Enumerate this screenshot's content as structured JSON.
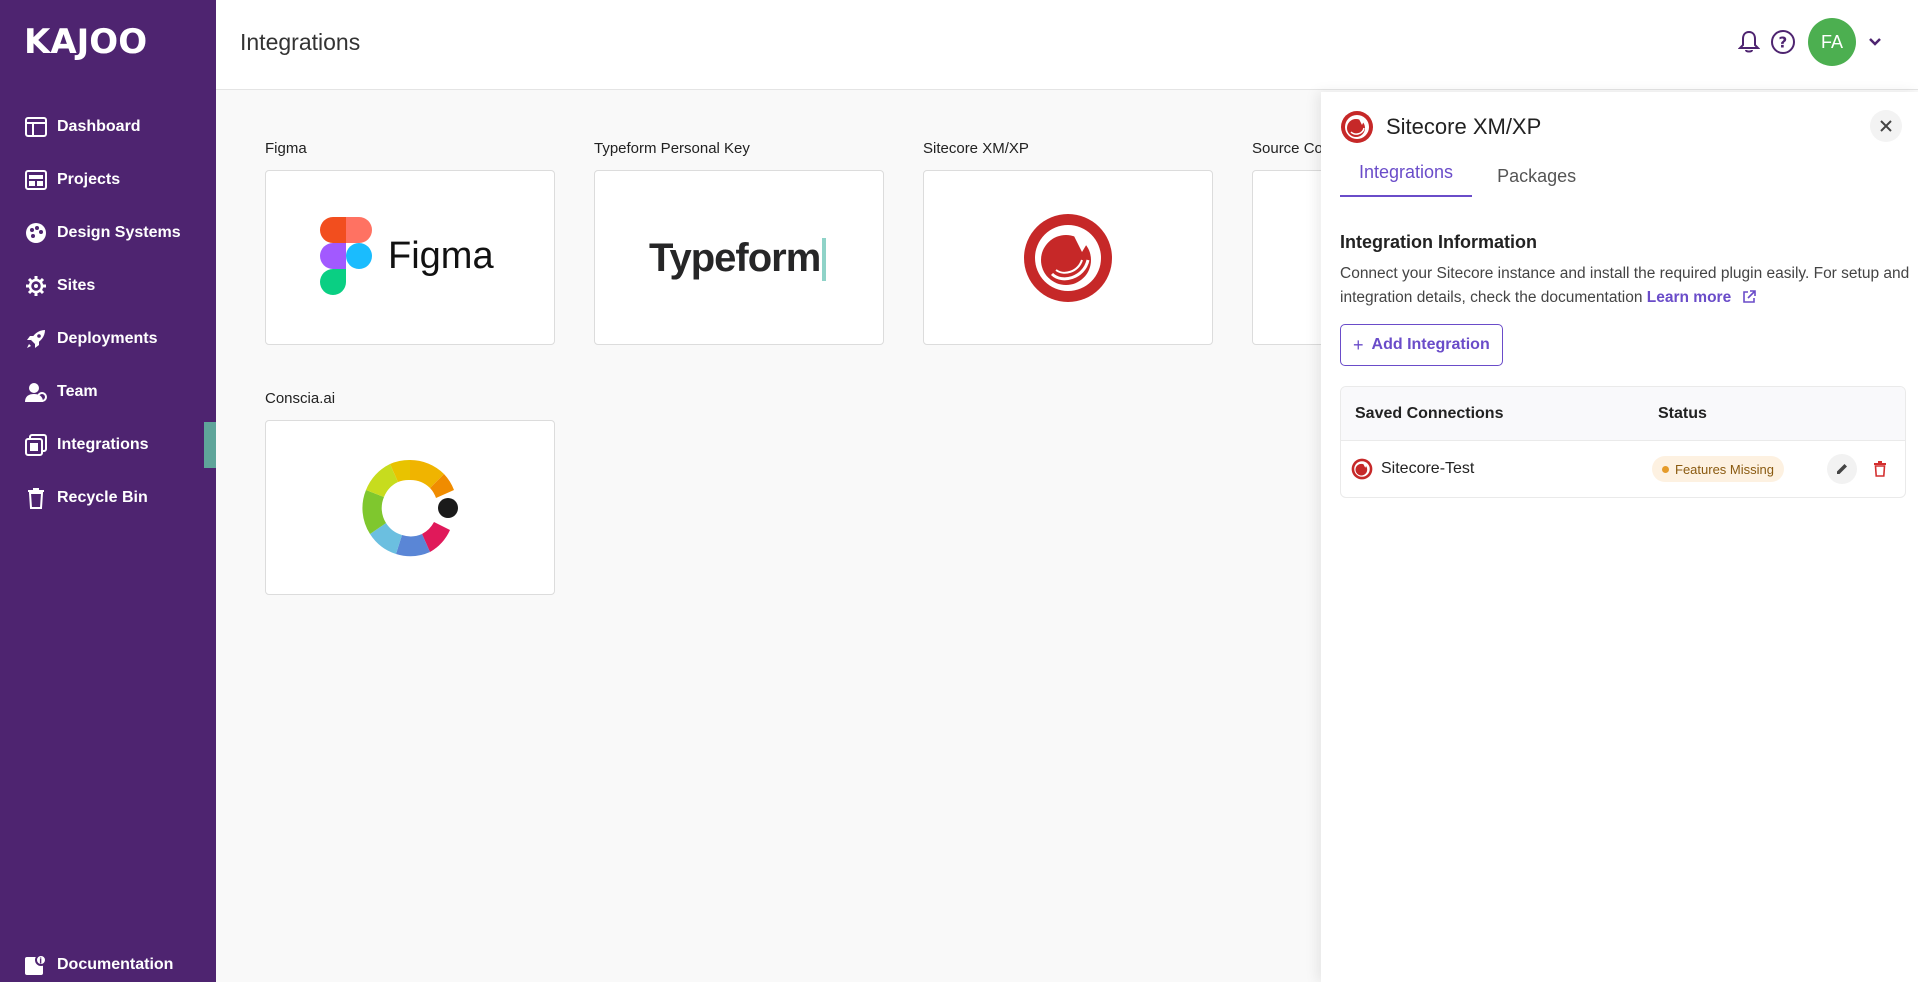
{
  "sidebar": {
    "brand": "KAJOO",
    "items": [
      {
        "label": "Dashboard"
      },
      {
        "label": "Projects"
      },
      {
        "label": "Design Systems"
      },
      {
        "label": "Sites"
      },
      {
        "label": "Deployments"
      },
      {
        "label": "Team"
      },
      {
        "label": "Integrations"
      },
      {
        "label": "Recycle Bin"
      }
    ],
    "bottom": {
      "label": "Documentation"
    }
  },
  "header": {
    "title": "Integrations",
    "avatar_initials": "FA"
  },
  "cards": [
    {
      "label": "Figma",
      "logo_text": "Figma"
    },
    {
      "label": "Typeform Personal Key",
      "logo_text": "Typeform"
    },
    {
      "label": "Sitecore XM/XP"
    },
    {
      "label": "Source Co"
    },
    {
      "label": "Conscia.ai"
    }
  ],
  "panel": {
    "title": "Sitecore XM/XP",
    "tabs": [
      {
        "label": "Integrations"
      },
      {
        "label": "Packages"
      }
    ],
    "info_title": "Integration Information",
    "info_text": "Connect your Sitecore instance and install the required plugin easily. For setup and integration details, check the documentation",
    "learn_more": "Learn more",
    "add_button": "Add Integration",
    "table": {
      "headers": [
        "Saved Connections",
        "Status"
      ],
      "rows": [
        {
          "name": "Sitecore-Test",
          "status": "Features Missing"
        }
      ]
    }
  },
  "colors": {
    "sidebar_bg": "#4e2470",
    "accent": "#6a4cc9",
    "active_marker": "#5fa59a",
    "avatar": "#4caf50",
    "sitecore_red": "#c62828",
    "warning": "#e59b2a",
    "danger": "#d32f2f"
  }
}
